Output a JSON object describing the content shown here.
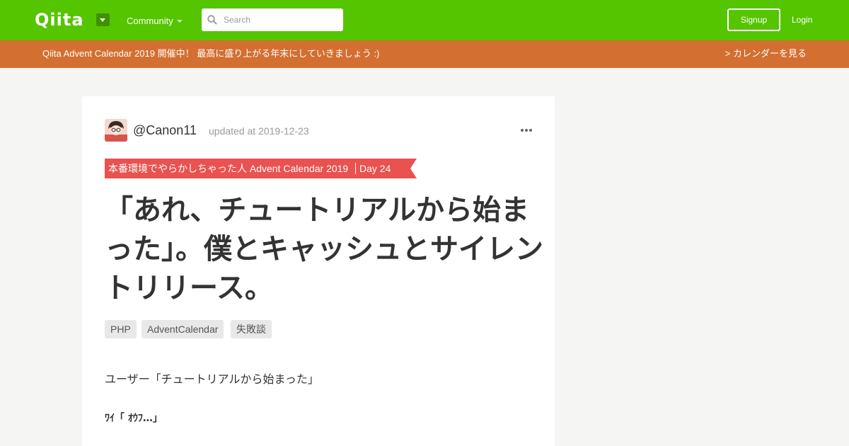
{
  "header": {
    "logo": "Qiita",
    "community_label": "Community",
    "search": {
      "placeholder": "Search",
      "value": ""
    },
    "signup_label": "Signup",
    "login_label": "Login",
    "icons": [
      "chevron-down-icon",
      "search-icon"
    ]
  },
  "banner": {
    "text": "Qiita Advent Calendar 2019 開催中！ 最高に盛り上がる年末にしていきましょう :)",
    "link_label": "> カレンダーを見る"
  },
  "article": {
    "author": "@Canon11",
    "updated": "updated at 2019-12-23",
    "calendar": {
      "name": "本番環境でやらかしちゃった人 Advent Calendar 2019",
      "day": "Day 24"
    },
    "title": "「あれ、チュートリアルから始まった」。僕とキャッシュとサイレントリリース。",
    "tags": [
      "PHP",
      "AdventCalendar",
      "失敗談"
    ],
    "body": [
      "ユーザー「チュートリアルから始まった」",
      "ﾜｲ「 ｵｳﾌ…」"
    ]
  },
  "colors": {
    "header_bg": "#55c500",
    "banner_bg": "#d36f31",
    "calendar_tag_bg": "#e9524f",
    "page_bg": "#f5f5f3"
  }
}
